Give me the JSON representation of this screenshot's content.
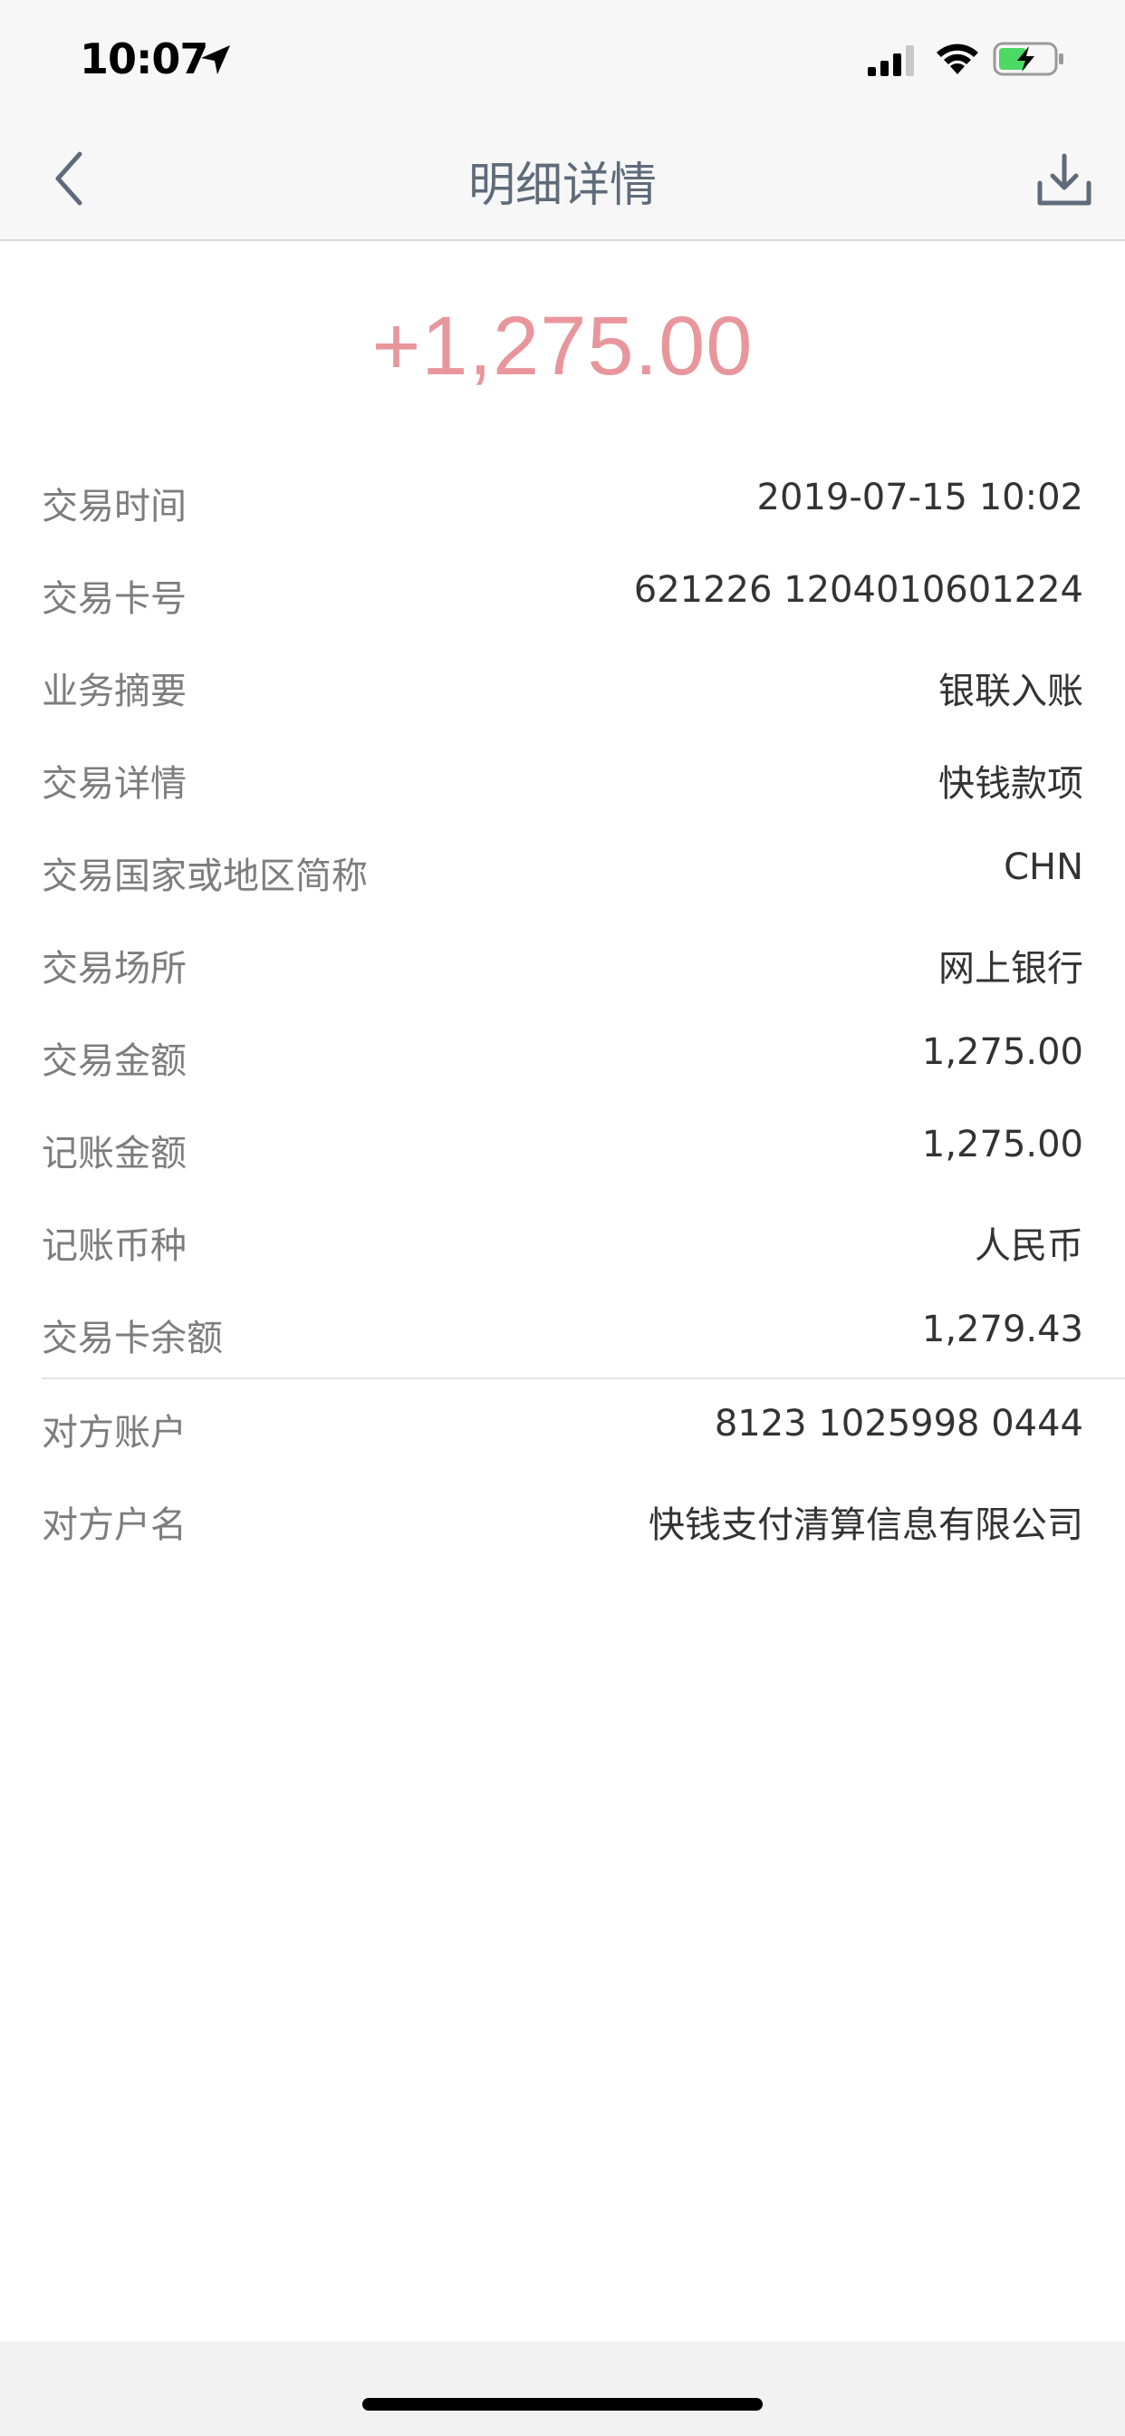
{
  "status_bar": {
    "time": "10:07"
  },
  "nav": {
    "title": "明细详情"
  },
  "amount": "+1,275.00",
  "details_group1": [
    {
      "label": "交易时间",
      "value": "2019-07-15 10:02"
    },
    {
      "label": "交易卡号",
      "value": "621226 1204010601224"
    },
    {
      "label": "业务摘要",
      "value": "银联入账"
    },
    {
      "label": "交易详情",
      "value": "快钱款项"
    },
    {
      "label": "交易国家或地区简称",
      "value": "CHN"
    },
    {
      "label": "交易场所",
      "value": "网上银行"
    },
    {
      "label": "交易金额",
      "value": "1,275.00"
    },
    {
      "label": "记账金额",
      "value": "1,275.00"
    },
    {
      "label": "记账币种",
      "value": "人民币"
    },
    {
      "label": "交易卡余额",
      "value": "1,279.43"
    }
  ],
  "details_group2": [
    {
      "label": "对方账户",
      "value": "8123 1025998 0444"
    },
    {
      "label": "对方户名",
      "value": "快钱支付清算信息有限公司"
    }
  ],
  "colors": {
    "amount": "#e8969c",
    "nav_title": "#5f6b7a",
    "label": "#7d7d7d",
    "value": "#333333"
  },
  "icons": {
    "back": "chevron-left-icon",
    "download": "download-icon",
    "location": "location-arrow-icon",
    "signal": "cellular-signal-icon",
    "wifi": "wifi-icon",
    "battery": "battery-charging-icon"
  }
}
